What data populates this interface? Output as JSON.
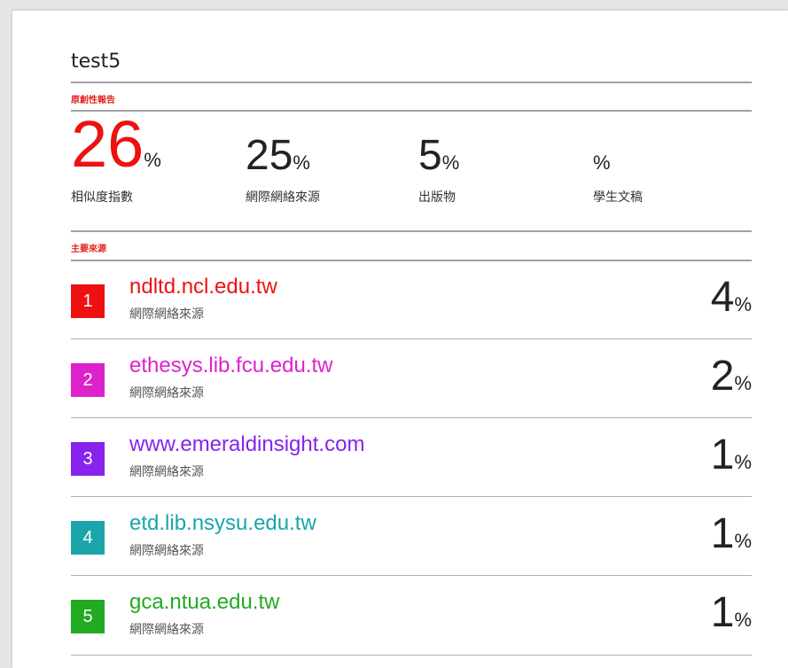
{
  "document": {
    "title": "test5"
  },
  "originality_section": {
    "label": "原創性報告",
    "stats": [
      {
        "value": "26",
        "unit": "%",
        "caption": "相似度指數",
        "color": "#ee1111"
      },
      {
        "value": "25",
        "unit": "%",
        "caption": "網際網絡來源",
        "color": "#222222"
      },
      {
        "value": "5",
        "unit": "%",
        "caption": "出版物",
        "color": "#222222"
      },
      {
        "value": "",
        "unit": "%",
        "caption": "學生文稿",
        "color": "#222222"
      }
    ]
  },
  "sources_section": {
    "label": "主要來源",
    "sources": [
      {
        "rank": "1",
        "name": "ndltd.ncl.edu.tw",
        "type": "網際網絡來源",
        "percent": "4",
        "unit": "%",
        "color": "#ee1111"
      },
      {
        "rank": "2",
        "name": "ethesys.lib.fcu.edu.tw",
        "type": "網際網絡來源",
        "percent": "2",
        "unit": "%",
        "color": "#dd22cc"
      },
      {
        "rank": "3",
        "name": "www.emeraldinsight.com",
        "type": "網際網絡來源",
        "percent": "1",
        "unit": "%",
        "color": "#8822ee"
      },
      {
        "rank": "4",
        "name": "etd.lib.nsysu.edu.tw",
        "type": "網際網絡來源",
        "percent": "1",
        "unit": "%",
        "color": "#1ba5ab"
      },
      {
        "rank": "5",
        "name": "gca.ntua.edu.tw",
        "type": "網際網絡來源",
        "percent": "1",
        "unit": "%",
        "color": "#22aa22"
      }
    ]
  }
}
